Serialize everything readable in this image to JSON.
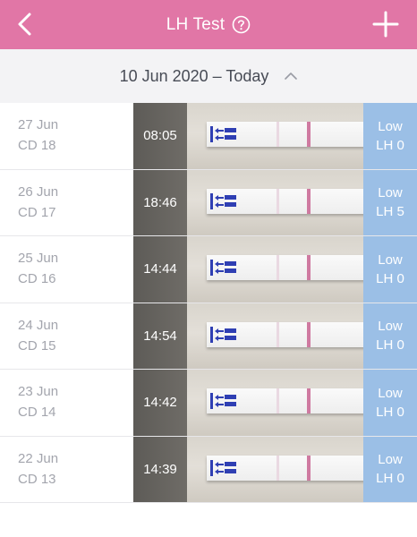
{
  "header": {
    "title": "LH Test",
    "back_icon": "chevron-left-icon",
    "help_icon": "question-circle-icon",
    "add_icon": "plus-icon",
    "bg_color": "#e176a6"
  },
  "range": {
    "label": "10 Jun 2020 – Today",
    "caret_icon": "chevron-up-icon"
  },
  "tests": [
    {
      "date": "27 Jun",
      "cd": "CD 18",
      "time": "08:05",
      "level": "Low",
      "lh": "LH 0"
    },
    {
      "date": "26 Jun",
      "cd": "CD 17",
      "time": "18:46",
      "level": "Low",
      "lh": "LH 5"
    },
    {
      "date": "25 Jun",
      "cd": "CD 16",
      "time": "14:44",
      "level": "Low",
      "lh": "LH 0"
    },
    {
      "date": "24 Jun",
      "cd": "CD 15",
      "time": "14:54",
      "level": "Low",
      "lh": "LH 0"
    },
    {
      "date": "23 Jun",
      "cd": "CD 14",
      "time": "14:42",
      "level": "Low",
      "lh": "LH 0"
    },
    {
      "date": "22 Jun",
      "cd": "CD 13",
      "time": "14:39",
      "level": "Low",
      "lh": "LH 0"
    }
  ]
}
